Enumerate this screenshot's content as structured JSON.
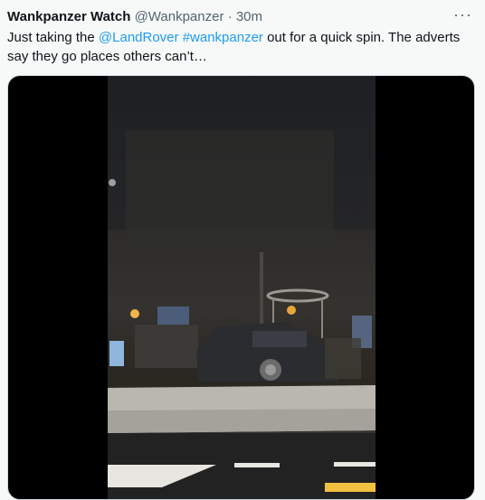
{
  "tweet": {
    "author_name": "Wankpanzer Watch",
    "handle": "@Wankpanzer",
    "separator": "·",
    "timestamp": "30m",
    "more_label": "···",
    "text_before": "Just taking the ",
    "mention": "@LandRover",
    "space": " ",
    "hashtag": "#wankpanzer",
    "text_after": " out for a quick spin. The adverts say they go places others can’t…"
  },
  "colors": {
    "link": "#1d9bf0",
    "secondary_text": "#536471",
    "background": "#f7f9f9"
  },
  "media": {
    "type": "video",
    "icon": "video-frame"
  }
}
